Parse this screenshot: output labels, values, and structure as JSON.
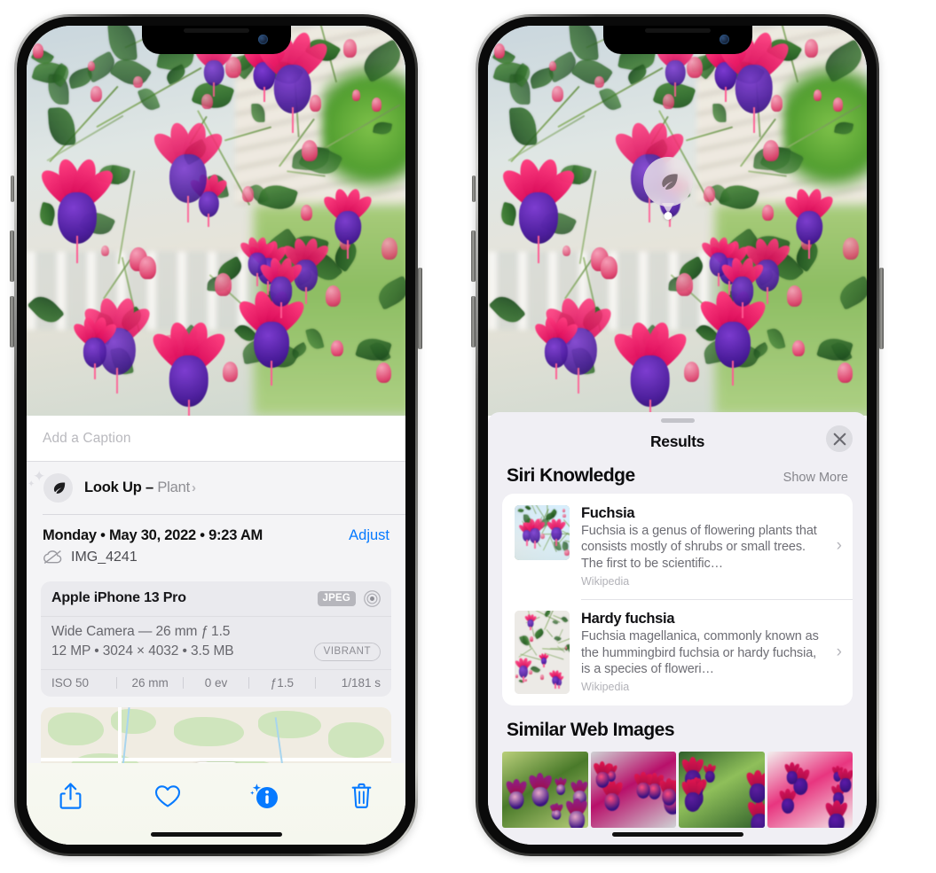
{
  "left_phone": {
    "name": "photos-info-screen",
    "caption": {
      "placeholder": "Add a Caption",
      "value": ""
    },
    "lookup": {
      "icon": "leaf-icon",
      "label": "Look Up – ",
      "subject": "Plant",
      "chevron": "›"
    },
    "metadata": {
      "date_line": "Monday • May 30, 2022 • 9:23 AM",
      "adjust_label": "Adjust",
      "cloud_icon": "cloud-slash-icon",
      "filename": "IMG_4241"
    },
    "camera_card": {
      "model": "Apple iPhone 13 Pro",
      "format_badge": "JPEG",
      "aperture_icon": "camera-aperture-icon",
      "lens_line": "Wide Camera — 26 mm ƒ 1.5",
      "size_line": "12 MP • 3024 × 4032 • 3.5 MB",
      "style_badge": "VIBRANT",
      "exif": [
        "ISO 50",
        "26 mm",
        "0 ev",
        "ƒ1.5",
        "1/181 s"
      ]
    },
    "map": {
      "name": "location-map",
      "pin": "photo-pin-thumbnail"
    },
    "toolbar": [
      {
        "name": "share-button",
        "icon": "share-icon"
      },
      {
        "name": "favorite-button",
        "icon": "heart-icon"
      },
      {
        "name": "info-button",
        "icon": "info-sparkle-icon"
      },
      {
        "name": "delete-button",
        "icon": "trash-icon"
      }
    ]
  },
  "right_phone": {
    "name": "visual-lookup-results-screen",
    "visual_badge": {
      "icon": "leaf-icon",
      "name": "visual-lookup-badge"
    },
    "sheet": {
      "title": "Results",
      "close_label": "✕"
    },
    "siri_knowledge": {
      "heading": "Siri Knowledge",
      "show_more": "Show More",
      "items": [
        {
          "title": "Fuchsia",
          "description": "Fuchsia is a genus of flowering plants that consists mostly of shrubs or small trees. The first to be scientific…",
          "source": "Wikipedia",
          "chevron": "›"
        },
        {
          "title": "Hardy fuchsia",
          "description": "Fuchsia magellanica, commonly known as the hummingbird fuchsia or hardy fuchsia, is a species of floweri…",
          "source": "Wikipedia",
          "chevron": "›"
        }
      ]
    },
    "similar_web_images": {
      "heading": "Similar Web Images",
      "count": 4
    }
  },
  "colors": {
    "accent_blue": "#067aff",
    "sheet_bg": "#f0eff4",
    "info_bg": "#f4f4f6",
    "card_bg": "#eaeaee",
    "secondary_text": "#8e8e93",
    "badge_gray": "#b6b6bc"
  }
}
